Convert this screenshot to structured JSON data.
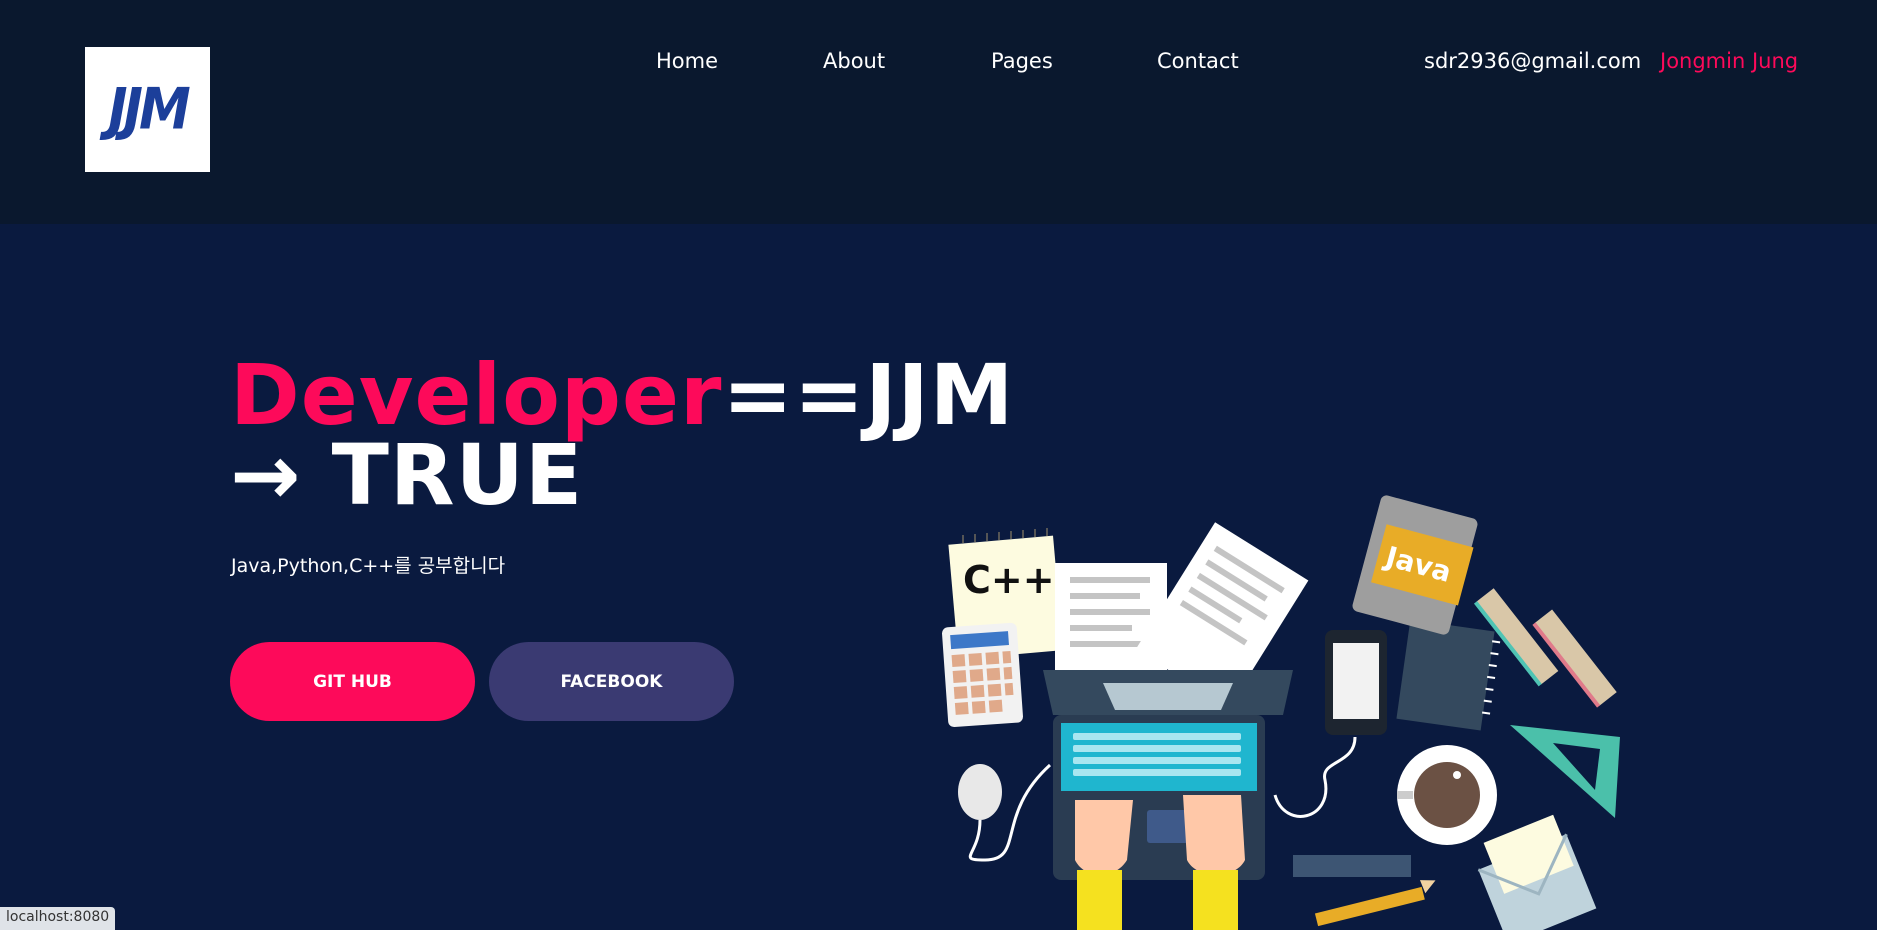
{
  "header": {
    "logo_text": "JJM",
    "nav": [
      "Home",
      "About",
      "Pages",
      "Contact"
    ],
    "email": "sdr2936@gmail.com",
    "user_name": "Jongmin Jung"
  },
  "hero": {
    "headline_pink": "Developer",
    "headline_white": "==JJM",
    "headline_line2": "→ TRUE",
    "subtitle": "Java,Python,C++를 공부합니다",
    "buttons": {
      "github": "GIT HUB",
      "facebook": "FACEBOOK"
    }
  },
  "illustration": {
    "notepad_text": "C++",
    "book_text": "Java"
  },
  "status_bar": "localhost:8080",
  "colors": {
    "accent": "#fd0a5a",
    "header_bg": "#0a182e",
    "hero_bg": "#0a1a3f",
    "secondary_button": "#3a3a72"
  }
}
